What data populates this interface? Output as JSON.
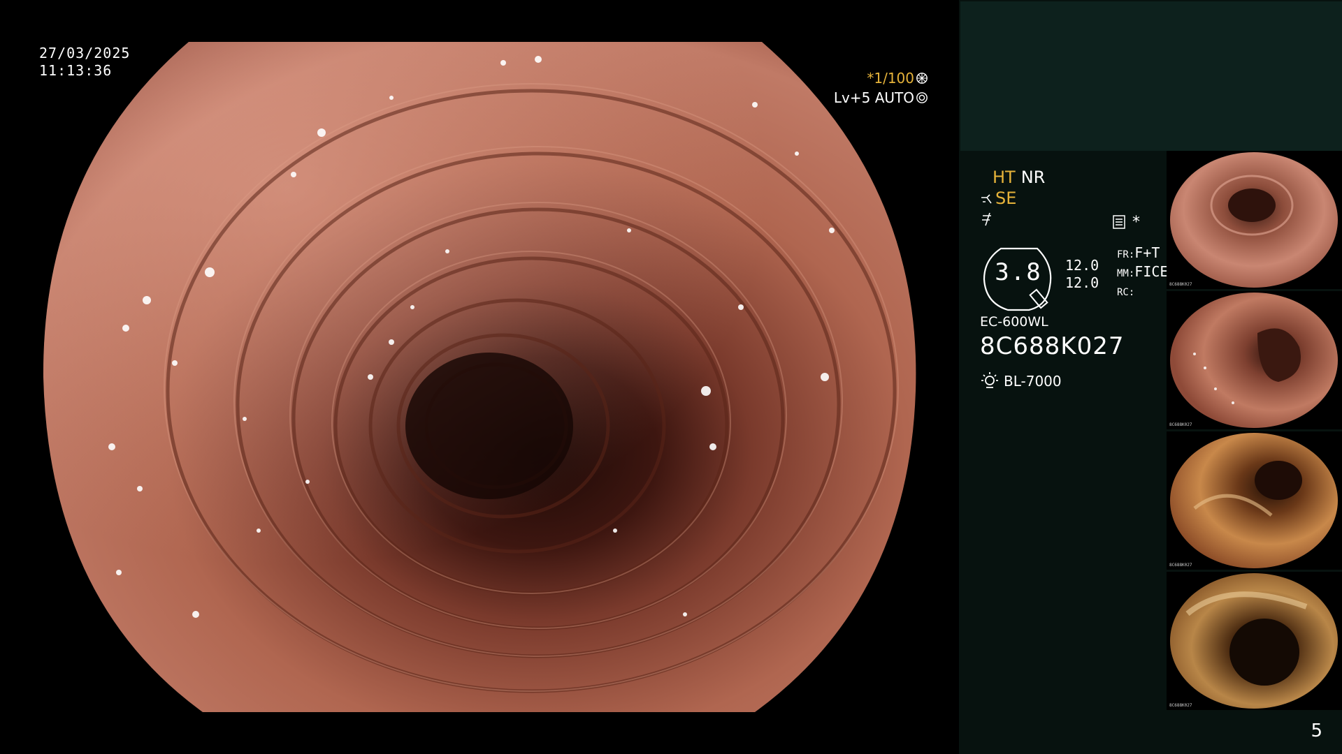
{
  "timestamp": {
    "date": "27/03/2025",
    "time": "11:13:36"
  },
  "exposure": {
    "shutter": "*1/100",
    "level": "Lv+5",
    "mode": "AUTO"
  },
  "settings": {
    "ht": "HT",
    "nr": "NR",
    "se": "SE",
    "misc_star": "*"
  },
  "gauge": {
    "value": "3.8",
    "num1": "12.0",
    "num2": "12.0"
  },
  "frame": {
    "fr_label": "FR:",
    "fr_value": "F+T",
    "mm_label": "MM:",
    "mm_value": "FICE",
    "rc_label": "RC:"
  },
  "scope": {
    "model": "EC-600WL",
    "serial": "8C688K027",
    "light_source": "BL-7000"
  },
  "thumbnails": [
    {
      "caption": "8C688K027"
    },
    {
      "caption": "8C688K027"
    },
    {
      "caption": "8C688K027"
    },
    {
      "caption": "8C688K027"
    }
  ],
  "page_number": "5",
  "colors": {
    "accent_yellow": "#e6b33a",
    "panel_bg": "#07120f",
    "panel_top": "#0d211d"
  }
}
